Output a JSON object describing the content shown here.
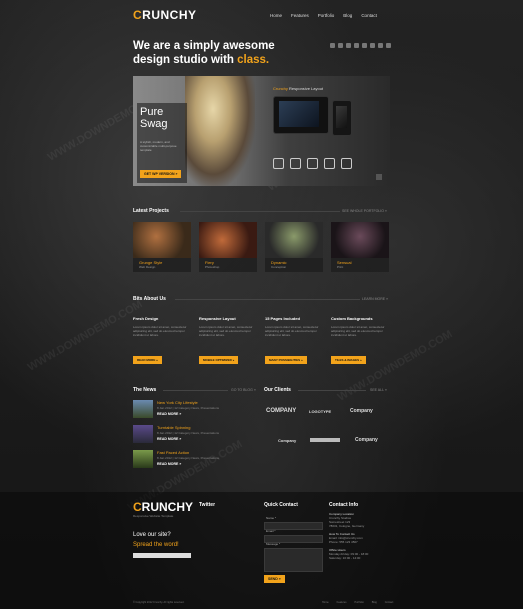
{
  "header": {
    "logo_first": "C",
    "logo_rest": "RUNCHY",
    "nav": [
      "Home",
      "Features",
      "Portfolio",
      "Blog",
      "Contact"
    ]
  },
  "headline": {
    "line1": "We are a simply awesome",
    "line2_pre": "design studio with ",
    "line2_accent": "class."
  },
  "hero": {
    "title": "Pure Swag",
    "desc": "A stylish, modern, and customizable multi-purpose template",
    "cta": "GET WP VERSION »",
    "device_title_accent": "Crunchy",
    "device_title_rest": " Responsive Layout"
  },
  "projects": {
    "title": "Latest Projects",
    "more": "SEE WHOLE PORTFOLIO »",
    "items": [
      {
        "title": "Grunge Style",
        "sub": "Web Design"
      },
      {
        "title": "Fiery",
        "sub": "Photoshop"
      },
      {
        "title": "Dynamic",
        "sub": "Conception"
      },
      {
        "title": "Sensual",
        "sub": "Print"
      }
    ]
  },
  "bits": {
    "title": "Bits About Us",
    "more": "LEARN MORE »",
    "items": [
      {
        "heading": "Fresh Design",
        "text": "Lorem ipsum dolor sit amet, consectetur adipisicing elit, sed do eiusmod tempor incididunt ut labore.",
        "button": "READ MORE »"
      },
      {
        "heading": "Responsive Layout",
        "text": "Lorem ipsum dolor sit amet, consectetur adipisicing elit, sed do eiusmod tempor incididunt ut labore.",
        "button": "MOBILE OPTIMIZED »"
      },
      {
        "heading": "15 Pages Included",
        "text": "Lorem ipsum dolor sit amet, consectetur adipisicing elit, sed do eiusmod tempor incididunt ut labore.",
        "button": "MANY POSSIBILITIES »"
      },
      {
        "heading": "Custom Backgrounds",
        "text": "Lorem ipsum dolor sit amet, consectetur adipisicing elit, sed do eiusmod tempor incididunt ut labore.",
        "button": "TILES & IMAGES »"
      }
    ]
  },
  "news": {
    "title": "The News",
    "more": "GO TO BLOG »",
    "items": [
      {
        "title": "New York City Lifestyle",
        "meta": "8 Jan 2012  |  12 Category News, Presentations",
        "read": "READ MORE »"
      },
      {
        "title": "Turntable Spinning",
        "meta": "8 Jan 2012  |  12 Category News, Presentations",
        "read": "READ MORE »"
      },
      {
        "title": "Fast Paced Action",
        "meta": "8 Jan 2012  |  12 Category News, Presentations",
        "read": "READ MORE »"
      }
    ]
  },
  "clients": {
    "title": "Our Clients",
    "more": "SEE ALL »",
    "logos": [
      "COMPANY",
      "LOGOTYPE",
      "Company",
      "Company",
      "",
      "Company"
    ]
  },
  "footer": {
    "logo_first": "C",
    "logo_rest": "RUNCHY",
    "tagline": "Responsive Website Template",
    "love": "Love our site?",
    "spread": "Spread the word!",
    "twitter": "Twitter",
    "quick_contact": "Quick Contact",
    "name_label": "Name *",
    "email_label": "Email *",
    "message_label": "Message *",
    "send": "SEND »",
    "contact_info": "Contact Info",
    "info_lines": [
      "Company Location",
      "Crunchy Studios",
      "Somestreet 123",
      "78031, Cologne, Germany",
      "",
      "How To Contact Us",
      "Email: info@crunchy.com",
      "Phone: 555 123 4567",
      "",
      "Office Hours",
      "Monday-Friday: 09:00 - 18:00",
      "Saturday: 10:00 - 14:00"
    ],
    "copyright": "© Copyright 2012 Crunchy. All rights reserved.",
    "nav": [
      "Home",
      "Features",
      "Portfolio",
      "Blog",
      "Contact"
    ]
  },
  "watermark": "WWW.DOWNDEMO.COM"
}
